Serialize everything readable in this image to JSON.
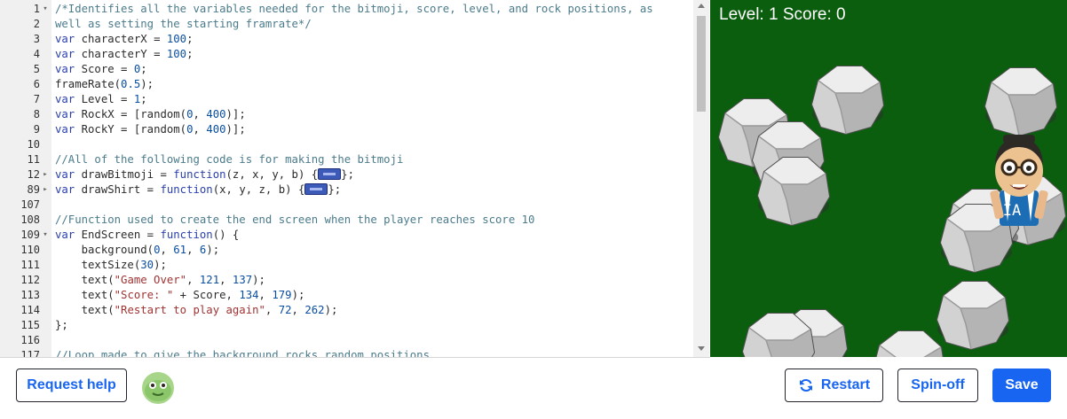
{
  "editor": {
    "lines": [
      {
        "n": "1",
        "fold": "▾",
        "html": "<span class='c'>/*Identifies all the variables needed for the bitmoji, score, level, and rock positions, as</span>"
      },
      {
        "n": "2",
        "fold": "",
        "html": "<span class='c'>well as setting the starting framrate*/</span>"
      },
      {
        "n": "3",
        "fold": "",
        "html": "<span class='k'>var</span> characterX <span class='op'>=</span> <span class='n'>100</span>;"
      },
      {
        "n": "4",
        "fold": "",
        "html": "<span class='k'>var</span> characterY <span class='op'>=</span> <span class='n'>100</span>;"
      },
      {
        "n": "5",
        "fold": "",
        "html": "<span class='k'>var</span> Score <span class='op'>=</span> <span class='n'>0</span>;"
      },
      {
        "n": "6",
        "fold": "",
        "html": "frameRate(<span class='n'>0.5</span>);"
      },
      {
        "n": "7",
        "fold": "",
        "html": "<span class='k'>var</span> Level <span class='op'>=</span> <span class='n'>1</span>;"
      },
      {
        "n": "8",
        "fold": "",
        "html": "<span class='k'>var</span> RockX <span class='op'>=</span> [random(<span class='n'>0</span>, <span class='n'>400</span>)];"
      },
      {
        "n": "9",
        "fold": "",
        "html": "<span class='k'>var</span> RockY <span class='op'>=</span> [random(<span class='n'>0</span>, <span class='n'>400</span>)];"
      },
      {
        "n": "10",
        "fold": "",
        "html": ""
      },
      {
        "n": "11",
        "fold": "",
        "html": "<span class='c'>//All of the following code is for making the bitmoji</span>"
      },
      {
        "n": "12",
        "fold": "▸",
        "html": "<span class='k'>var</span> drawBitmoji <span class='op'>=</span> <span class='k'>function</span>(z, x, y, b) {<span class='fold-marker'></span>};"
      },
      {
        "n": "89",
        "fold": "▸",
        "html": "<span class='k'>var</span> drawShirt <span class='op'>=</span> <span class='k'>function</span>(x, y, z, b) {<span class='fold-marker'></span>};"
      },
      {
        "n": "107",
        "fold": "",
        "html": ""
      },
      {
        "n": "108",
        "fold": "",
        "html": "<span class='c'>//Function used to create the end screen when the player reaches score 10</span>"
      },
      {
        "n": "109",
        "fold": "▾",
        "html": "<span class='k'>var</span> EndScreen <span class='op'>=</span> <span class='k'>function</span>() {"
      },
      {
        "n": "110",
        "fold": "",
        "html": "    background(<span class='n'>0</span>, <span class='n'>61</span>, <span class='n'>6</span>);"
      },
      {
        "n": "111",
        "fold": "",
        "html": "    textSize(<span class='n'>30</span>);"
      },
      {
        "n": "112",
        "fold": "",
        "html": "    text(<span class='s'>\"Game Over\"</span>, <span class='n'>121</span>, <span class='n'>137</span>);"
      },
      {
        "n": "113",
        "fold": "",
        "html": "    text(<span class='s'>\"Score: \"</span> + Score, <span class='n'>134</span>, <span class='n'>179</span>);"
      },
      {
        "n": "114",
        "fold": "",
        "html": "    text(<span class='s'>\"Restart to play again\"</span>, <span class='n'>72</span>, <span class='n'>262</span>);"
      },
      {
        "n": "115",
        "fold": "",
        "html": "};"
      },
      {
        "n": "116",
        "fold": "",
        "html": ""
      },
      {
        "n": "117",
        "fold": "",
        "html": "<span class='c'>//Loop made to give the background rocks random positions</span>"
      }
    ]
  },
  "canvas": {
    "hud_text": "Level: 1 Score: 0",
    "background_color": "#0b5e0e",
    "shirt_text": "IA"
  },
  "bottom_bar": {
    "request_help_label": "Request help",
    "restart_label": "Restart",
    "spinoff_label": "Spin-off",
    "save_label": "Save"
  },
  "colors": {
    "accent": "#1865f2"
  }
}
